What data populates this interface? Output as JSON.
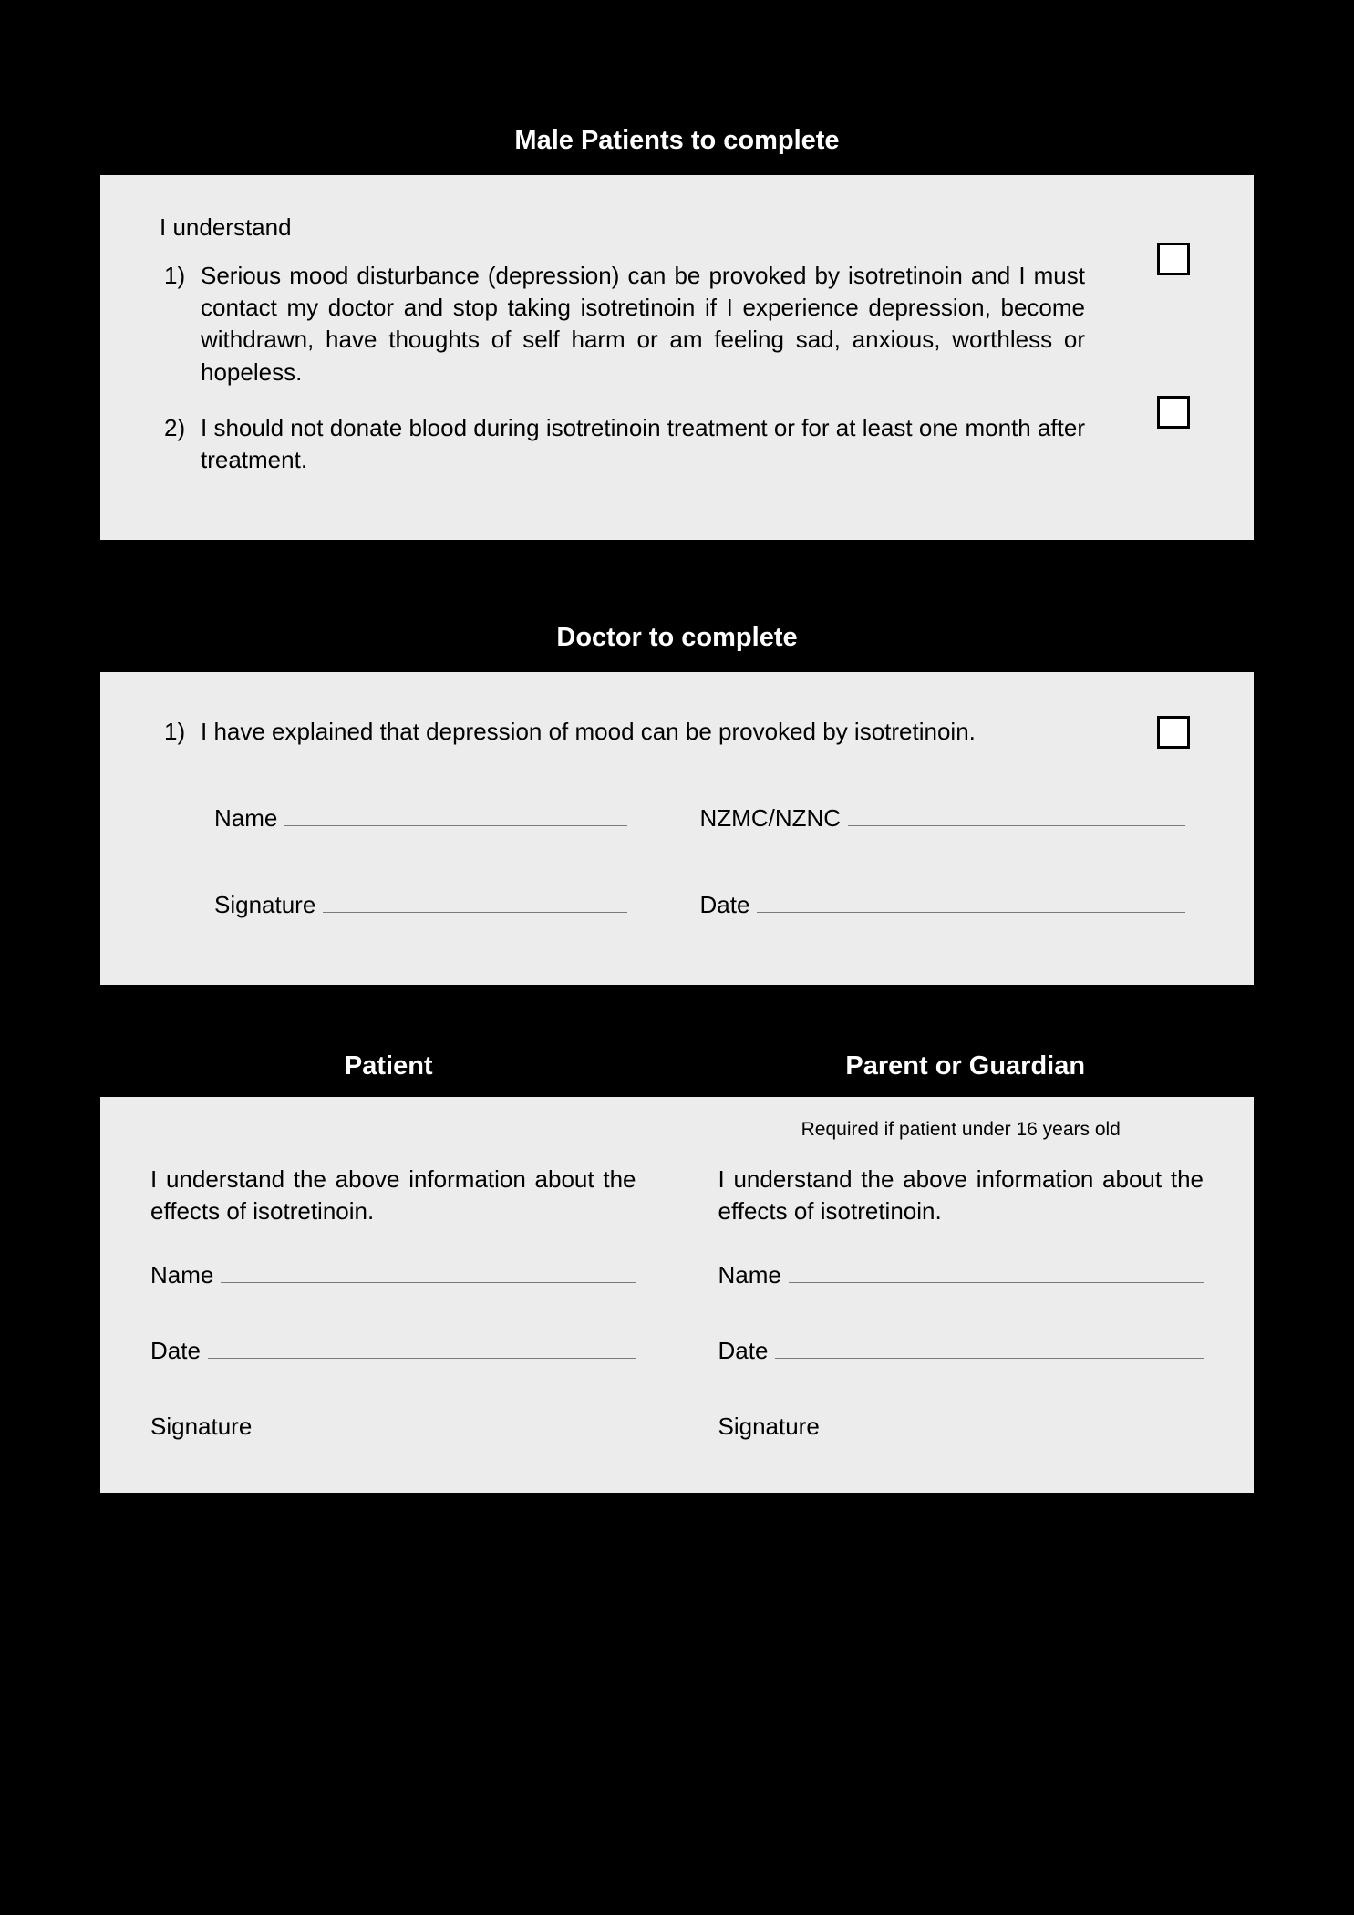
{
  "male_section": {
    "header": "Male Patients to complete",
    "intro": "I understand",
    "items": [
      {
        "num": "1)",
        "text": "Serious mood disturbance (depression) can be provoked by isotretinoin and I must contact my doctor and stop taking isotretinoin if I experience depression, become withdrawn, have thoughts of self harm or am feeling sad, anxious, worthless or hopeless."
      },
      {
        "num": "2)",
        "text": "I should not donate blood during isotretinoin treatment or for at least one month after treatment."
      }
    ]
  },
  "doctor_section": {
    "header": "Doctor to complete",
    "items": [
      {
        "num": "1)",
        "text": "I have explained that depression of mood can be provoked by isotretinoin."
      }
    ],
    "fields": {
      "name": "Name",
      "nzmc": "NZMC/NZNC",
      "signature": "Signature",
      "date": "Date"
    }
  },
  "sign_section": {
    "headers": {
      "patient": "Patient",
      "guardian": "Parent or Guardian"
    },
    "guardian_note": "Required if patient under 16 years old",
    "understand_text": "I understand the above information about the effects of isotretinoin.",
    "fields": {
      "name": "Name",
      "date": "Date",
      "signature": "Signature"
    }
  }
}
